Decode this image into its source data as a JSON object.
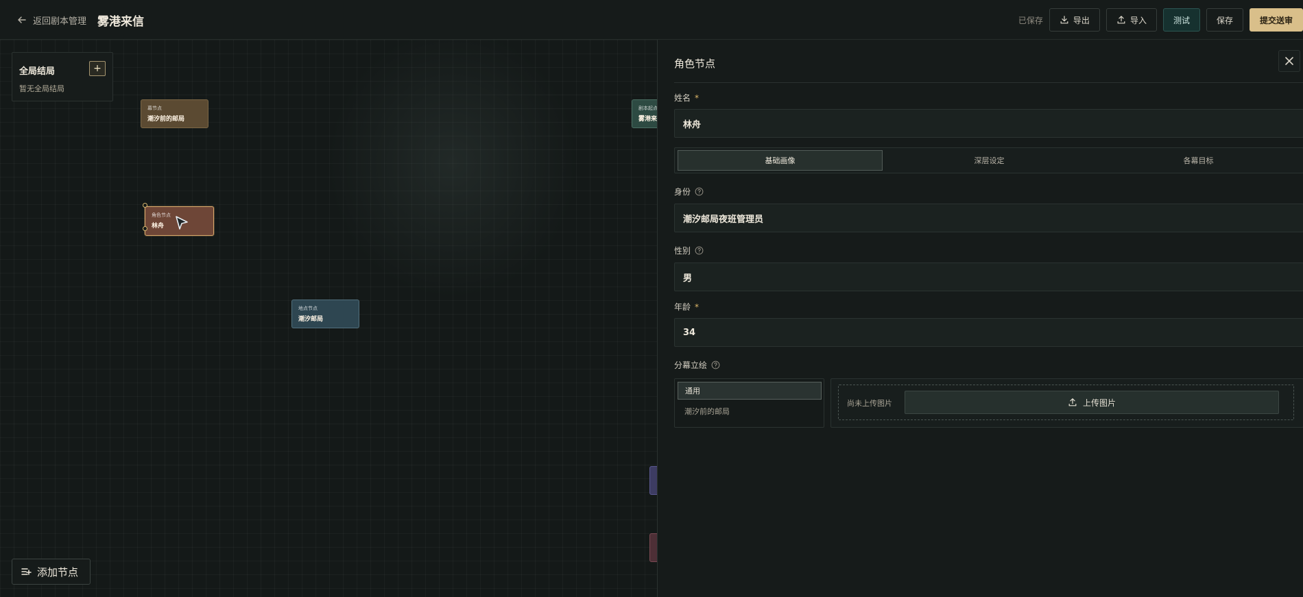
{
  "topbar": {
    "back_label": "返回剧本管理",
    "script_title": "雾港来信",
    "saved_status": "已保存",
    "export_label": "导出",
    "import_label": "导入",
    "test_label": "测试",
    "save_label": "保存",
    "submit_label": "提交送审"
  },
  "canvas": {
    "global_endings": {
      "title": "全局结局",
      "add_label": "+",
      "empty_text": "暂无全局结局"
    },
    "nodes": {
      "act": {
        "type": "幕节点",
        "name": "潮汐前的邮局"
      },
      "role": {
        "type": "角色节点",
        "name": "林舟"
      },
      "place": {
        "type": "地点节点",
        "name": "潮汐邮局"
      },
      "start": {
        "type": "剧本起点",
        "name": "雾港来信"
      }
    },
    "add_node_label": "添加节点"
  },
  "panel": {
    "title": "角色节点",
    "close_icon": "close-icon",
    "name_label": "姓名",
    "name_value": "林舟",
    "tabs": [
      "基础画像",
      "深层设定",
      "各幕目标"
    ],
    "active_tab": "基础画像",
    "identity_label": "身份",
    "identity_value": "潮汐邮局夜班管理员",
    "gender_label": "性别",
    "gender_value": "男",
    "age_label": "年龄",
    "age_value": "34",
    "portrait_label": "分幕立绘",
    "portrait_items": [
      "通用",
      "潮汐前的邮局"
    ],
    "no_image_text": "尚未上传图片",
    "upload_label": "上传图片",
    "required_mark": "*"
  },
  "colors": {
    "accent_gold": "#d9bf8a",
    "test_teal": "#16312f",
    "role_node": "#6e4637",
    "act_node": "#5b4a32",
    "place_node": "#2e4651"
  }
}
